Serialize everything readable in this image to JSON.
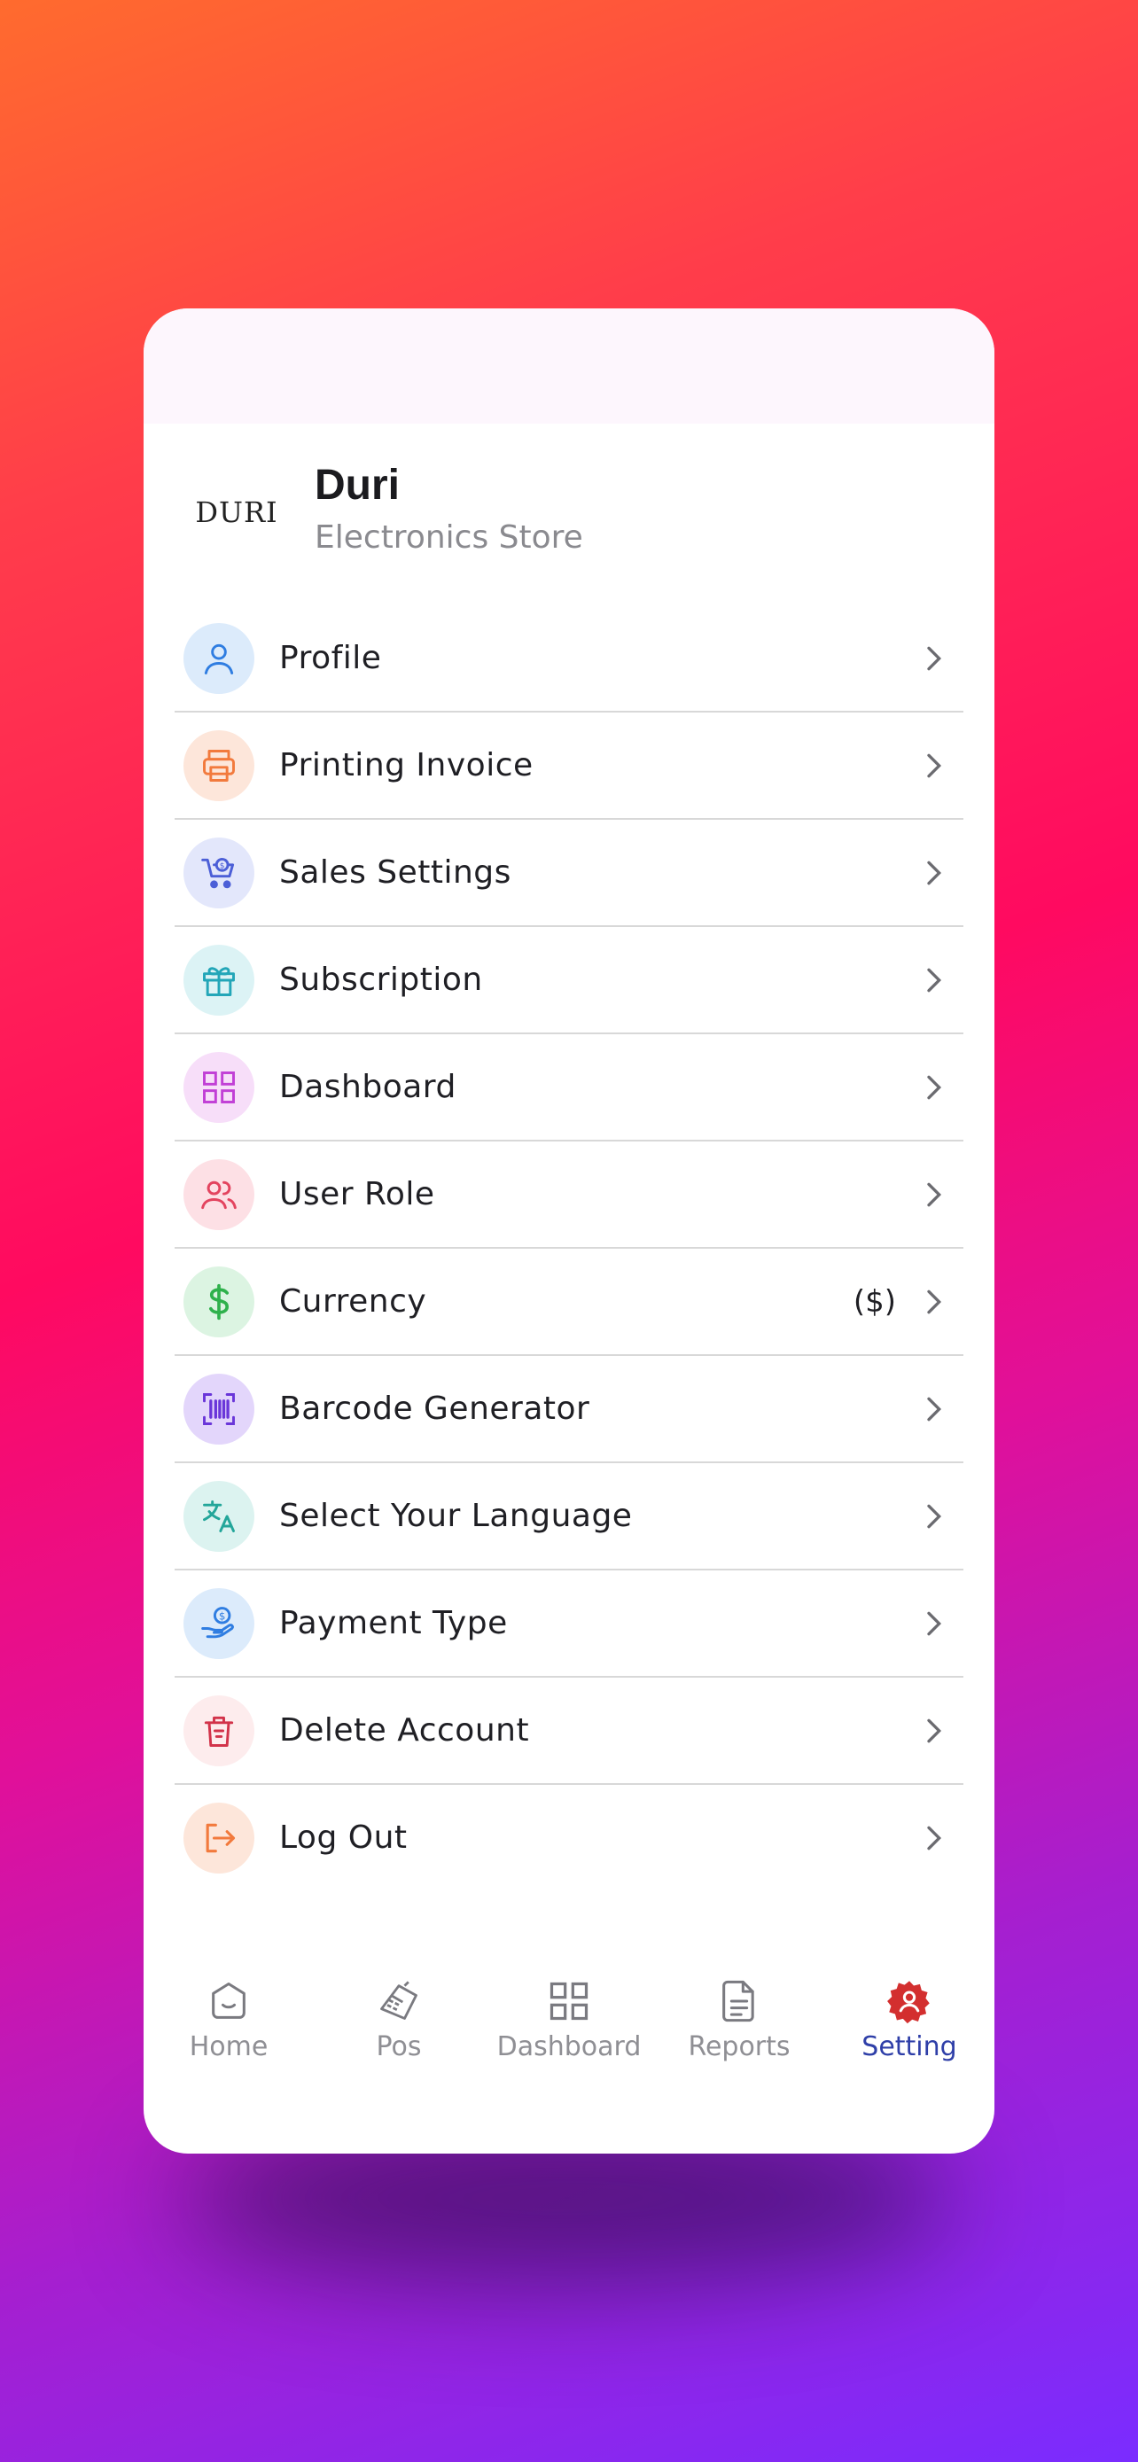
{
  "store": {
    "name": "Duri",
    "type": "Electronics Store",
    "logo_text": "DURI"
  },
  "menu": [
    {
      "label": "Profile",
      "icon": "user-icon",
      "color": "#2f7de1",
      "bg": "#dcebfb"
    },
    {
      "label": "Printing Invoice",
      "icon": "printer-icon",
      "color": "#f27a3d",
      "bg": "#fde6da"
    },
    {
      "label": "Sales Settings",
      "icon": "cart-icon",
      "color": "#4c5fd7",
      "bg": "#e3e7fb"
    },
    {
      "label": "Subscription",
      "icon": "gift-icon",
      "color": "#23a6b8",
      "bg": "#dcf3f5"
    },
    {
      "label": "Dashboard",
      "icon": "grid-icon",
      "color": "#c13fd6",
      "bg": "#f7def9"
    },
    {
      "label": "User Role",
      "icon": "users-icon",
      "color": "#e3445f",
      "bg": "#fde0e5"
    },
    {
      "label": "Currency",
      "value": "($)",
      "icon": "dollar-icon",
      "color": "#2fb14c",
      "bg": "#dcf4e2"
    },
    {
      "label": "Barcode Generator",
      "icon": "barcode-icon",
      "color": "#6a36d9",
      "bg": "#e3d6fb"
    },
    {
      "label": "Select Your Language",
      "icon": "translate-icon",
      "color": "#23a69a",
      "bg": "#dcf3f0"
    },
    {
      "label": "Payment Type",
      "icon": "payment-icon",
      "color": "#2f7de1",
      "bg": "#dcebfb"
    },
    {
      "label": "Delete Account",
      "icon": "trash-icon",
      "color": "#d2334a",
      "bg": "#fdeced"
    },
    {
      "label": "Log Out",
      "icon": "logout-icon",
      "color": "#f27a3d",
      "bg": "#fde6da"
    }
  ],
  "nav": [
    {
      "label": "Home",
      "icon": "home-icon",
      "active": false
    },
    {
      "label": "Pos",
      "icon": "pos-terminal-icon",
      "active": false
    },
    {
      "label": "Dashboard",
      "icon": "grid-icon",
      "active": false
    },
    {
      "label": "Reports",
      "icon": "document-icon",
      "active": false
    },
    {
      "label": "Setting",
      "icon": "gear-user-icon",
      "active": true
    }
  ],
  "colors": {
    "active_nav": "#2f3fa8",
    "settings_icon": "#d32f2f"
  }
}
